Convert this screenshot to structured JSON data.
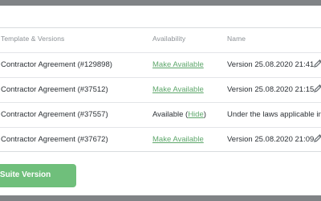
{
  "table": {
    "headers": {
      "template": "Template & Versions",
      "availability": "Availability",
      "name": "Name"
    },
    "rows": [
      {
        "template": "Contractor Agreement (#129898)",
        "availability_link": "Make Available",
        "name": "Version 25.08.2020 21:41"
      },
      {
        "template": "Contractor Agreement (#37512)",
        "availability_link": "Make Available",
        "name": "Version 25.08.2020 21:15"
      },
      {
        "template": "Contractor Agreement (#37557)",
        "availability_prefix": "Available (",
        "availability_link": "Hide",
        "availability_suffix": ")",
        "name": "Under the laws applicable in Z"
      },
      {
        "template": "Contractor Agreement (#37672)",
        "availability_link": "Make Available",
        "name": "Version 25.08.2020 21:09"
      }
    ]
  },
  "button": {
    "label": "Create Suite Version"
  },
  "colors": {
    "accent": "#6fbf7b",
    "link": "#5ea76b",
    "frame": "#808386"
  }
}
